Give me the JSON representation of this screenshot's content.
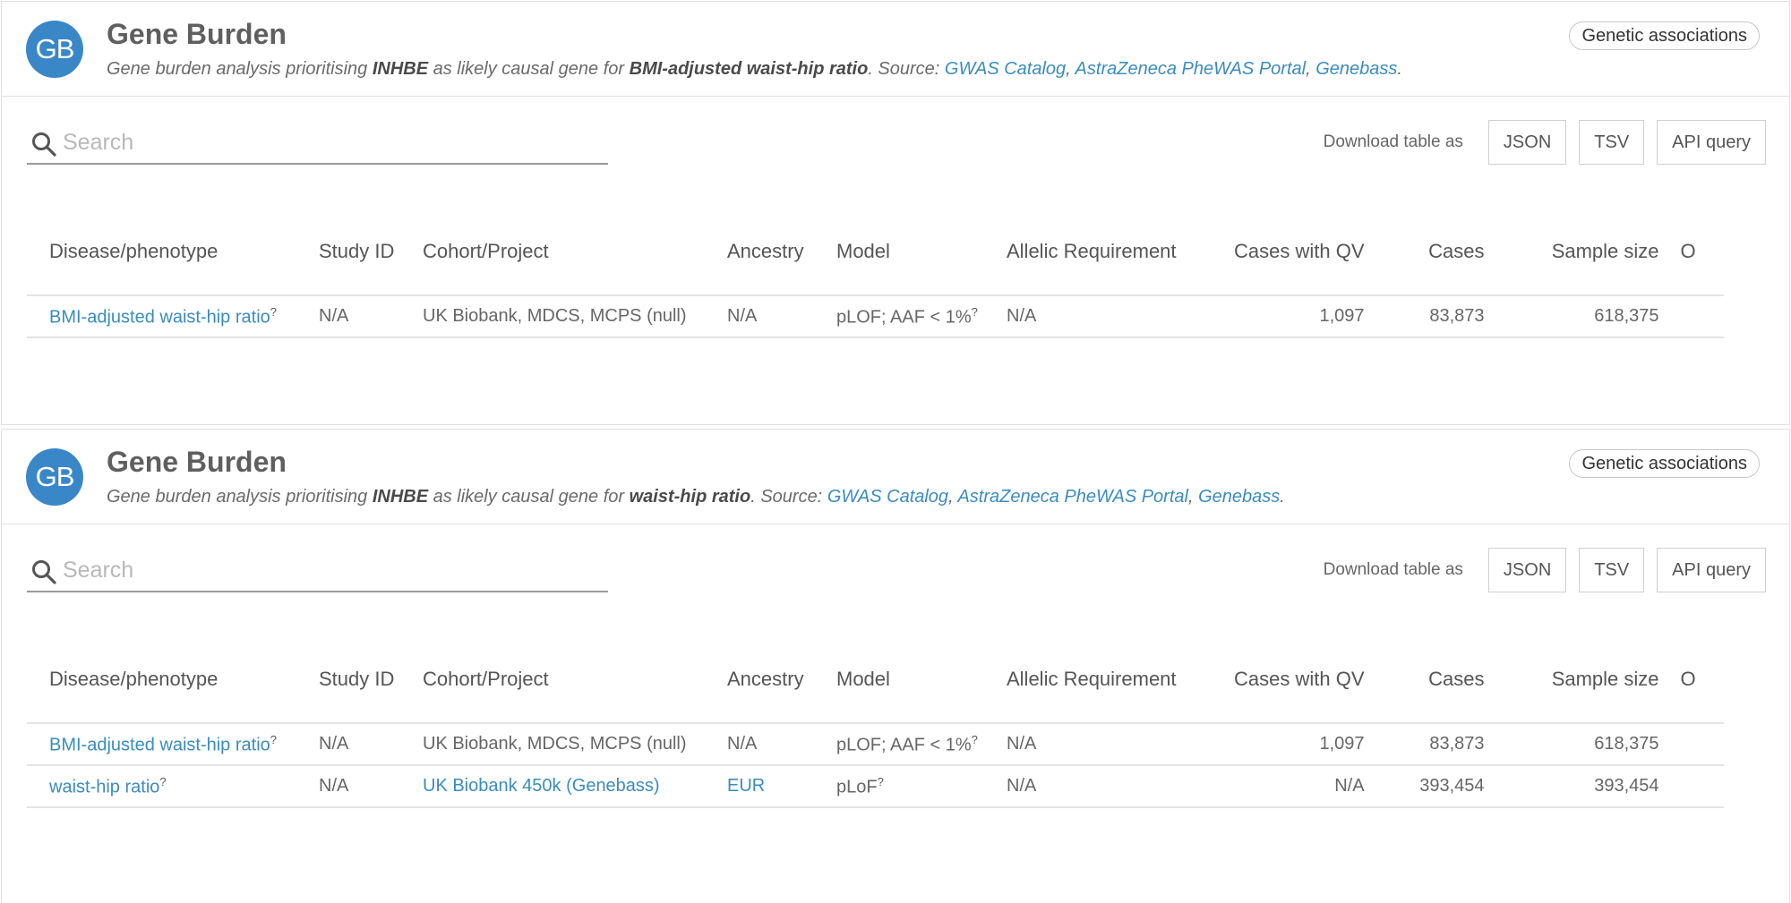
{
  "panels": [
    {
      "avatar": "GB",
      "title": "Gene Burden",
      "desc": {
        "prefix": "Gene burden analysis prioritising ",
        "gene": "INHBE",
        "middle": " as likely causal gene for ",
        "trait": "BMI-adjusted waist-hip ratio",
        "source_label": ". Source: ",
        "sources": [
          "GWAS Catalog",
          "AstraZeneca PheWAS Portal",
          "Genebass"
        ],
        "sep": ", ",
        "end": "."
      },
      "chip": "Genetic associations",
      "search": {
        "placeholder": "Search",
        "value": ""
      },
      "download": {
        "label": "Download table as",
        "buttons": [
          "JSON",
          "TSV",
          "API query"
        ]
      },
      "columns": [
        "Disease/phenotype",
        "Study ID",
        "Cohort/Project",
        "Ancestry",
        "Model",
        "Allelic Requirement",
        "Cases with QV",
        "Cases",
        "Sample size",
        "O"
      ],
      "rows": [
        {
          "phenotype": "BMI-adjusted waist-hip ratio",
          "study_id": "N/A",
          "cohort": "UK Biobank, MDCS, MCPS (null)",
          "cohort_link": false,
          "ancestry": "N/A",
          "ancestry_link": false,
          "model": "pLOF; AAF < 1%",
          "allelic": "N/A",
          "cases_qv": "1,097",
          "cases": "83,873",
          "sample_size": "618,375"
        }
      ]
    },
    {
      "avatar": "GB",
      "title": "Gene Burden",
      "desc": {
        "prefix": "Gene burden analysis prioritising ",
        "gene": "INHBE",
        "middle": " as likely causal gene for ",
        "trait": "waist-hip ratio",
        "source_label": ". Source: ",
        "sources": [
          "GWAS Catalog",
          "AstraZeneca PheWAS Portal",
          "Genebass"
        ],
        "sep": ", ",
        "end": "."
      },
      "chip": "Genetic associations",
      "search": {
        "placeholder": "Search",
        "value": ""
      },
      "download": {
        "label": "Download table as",
        "buttons": [
          "JSON",
          "TSV",
          "API query"
        ]
      },
      "columns": [
        "Disease/phenotype",
        "Study ID",
        "Cohort/Project",
        "Ancestry",
        "Model",
        "Allelic Requirement",
        "Cases with QV",
        "Cases",
        "Sample size",
        "O"
      ],
      "rows": [
        {
          "phenotype": "BMI-adjusted waist-hip ratio",
          "study_id": "N/A",
          "cohort": "UK Biobank, MDCS, MCPS (null)",
          "cohort_link": false,
          "ancestry": "N/A",
          "ancestry_link": false,
          "model": "pLOF; AAF < 1%",
          "allelic": "N/A",
          "cases_qv": "1,097",
          "cases": "83,873",
          "sample_size": "618,375"
        },
        {
          "phenotype": "waist-hip ratio",
          "study_id": "N/A",
          "cohort": "UK Biobank 450k (Genebass)",
          "cohort_link": true,
          "ancestry": "EUR",
          "ancestry_link": true,
          "model": "pLoF",
          "allelic": "N/A",
          "cases_qv": "N/A",
          "cases": "393,454",
          "sample_size": "393,454"
        }
      ]
    }
  ],
  "tooltip_marker": "?",
  "colors": {
    "avatar": "#3a87c8",
    "link": "#3a8cc0"
  }
}
